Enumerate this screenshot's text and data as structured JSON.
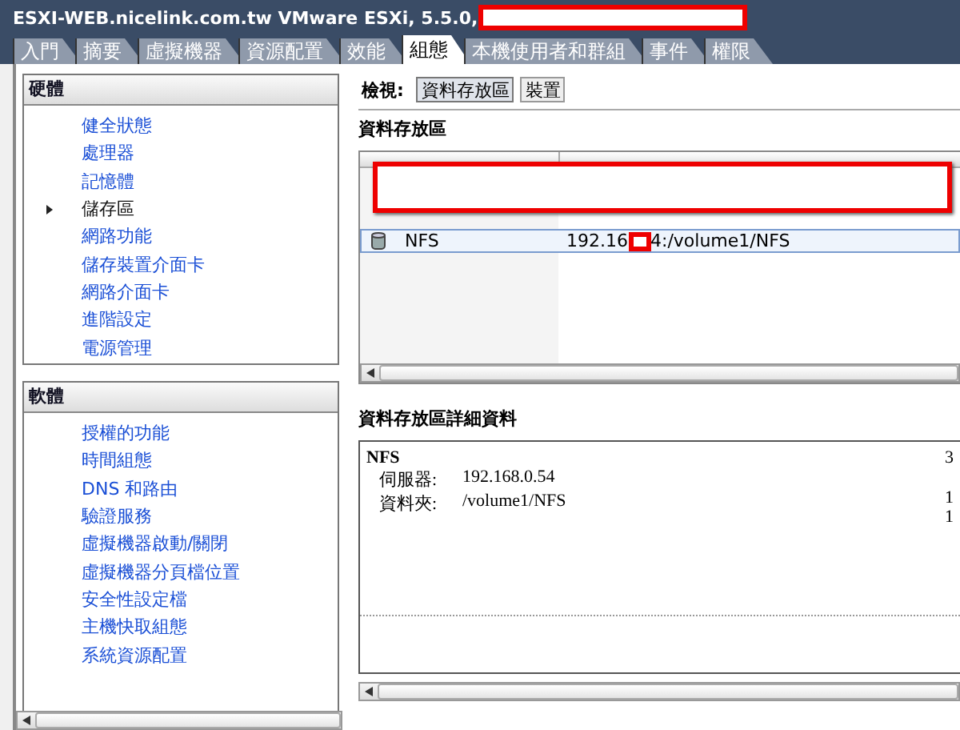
{
  "window": {
    "title": "ESXI-WEB.nicelink.com.tw VMware ESXi, 5.5.0,",
    "redacted": true
  },
  "tabs": [
    {
      "label": "入門",
      "selected": false
    },
    {
      "label": "摘要",
      "selected": false
    },
    {
      "label": "虛擬機器",
      "selected": false
    },
    {
      "label": "資源配置",
      "selected": false
    },
    {
      "label": "效能",
      "selected": false
    },
    {
      "label": "組態",
      "selected": true
    },
    {
      "label": "本機使用者和群組",
      "selected": false
    },
    {
      "label": "事件",
      "selected": false
    },
    {
      "label": "權限",
      "selected": false
    }
  ],
  "sidebar": [
    {
      "title": "硬體",
      "items": [
        {
          "label": "健全狀態",
          "selected": false
        },
        {
          "label": "處理器",
          "selected": false
        },
        {
          "label": "記憶體",
          "selected": false
        },
        {
          "label": "儲存區",
          "selected": true
        },
        {
          "label": "網路功能",
          "selected": false
        },
        {
          "label": "儲存裝置介面卡",
          "selected": false
        },
        {
          "label": "網路介面卡",
          "selected": false
        },
        {
          "label": "進階設定",
          "selected": false
        },
        {
          "label": "電源管理",
          "selected": false
        }
      ]
    },
    {
      "title": "軟體",
      "items": [
        {
          "label": "授權的功能",
          "selected": false
        },
        {
          "label": "時間組態",
          "selected": false
        },
        {
          "label": "DNS 和路由",
          "selected": false
        },
        {
          "label": "驗證服務",
          "selected": false
        },
        {
          "label": "虛擬機器啟動/關閉",
          "selected": false
        },
        {
          "label": "虛擬機器分頁檔位置",
          "selected": false
        },
        {
          "label": "安全性設定檔",
          "selected": false
        },
        {
          "label": "主機快取組態",
          "selected": false
        },
        {
          "label": "系統資源配置",
          "selected": false
        }
      ]
    }
  ],
  "view": {
    "label": "檢視:",
    "buttons": [
      {
        "label": "資料存放區",
        "selected": true
      },
      {
        "label": "裝置",
        "selected": false
      }
    ]
  },
  "datastores": {
    "title": "資料存放區",
    "redacted": true,
    "rows": [
      {
        "name": "NFS",
        "device_start": "192.16",
        "device_end": "4:/volume1/NFS",
        "device_redacted": true,
        "selected": true
      }
    ]
  },
  "details": {
    "title": "資料存放區詳細資料",
    "name": "NFS",
    "fields": [
      {
        "label": "伺服器:",
        "value": "192.168.0.54"
      },
      {
        "label": "資料夾:",
        "value": "/volume1/NFS"
      }
    ],
    "column_2": [
      "3",
      "1",
      "1"
    ]
  }
}
